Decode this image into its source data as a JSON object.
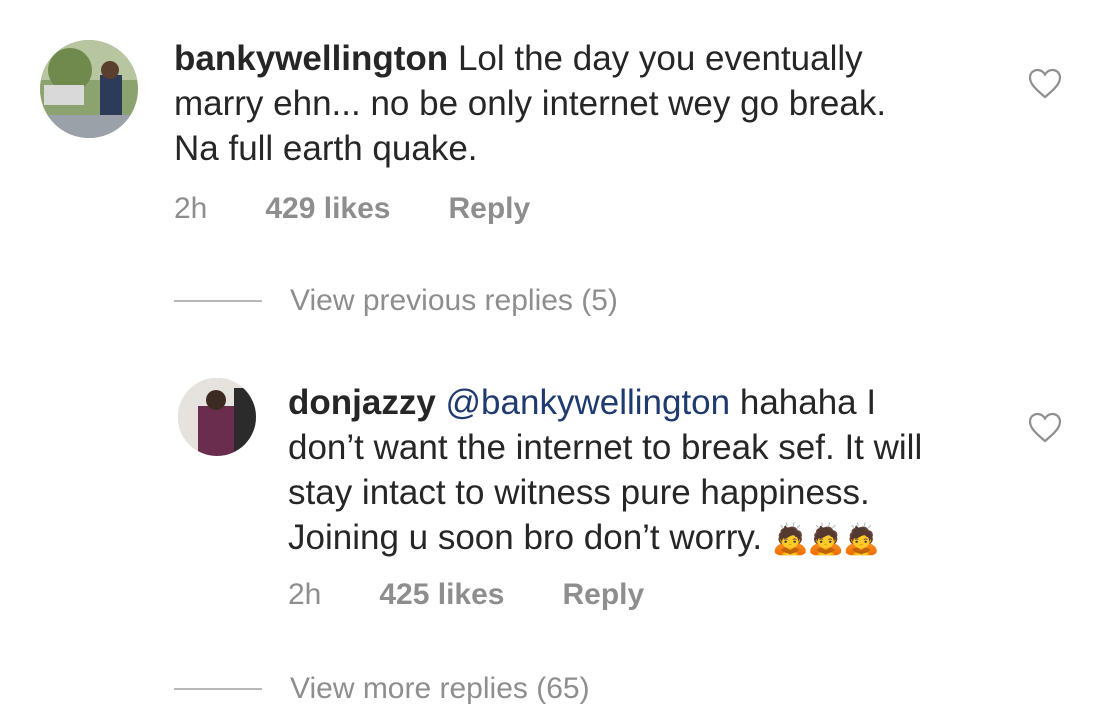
{
  "comments": [
    {
      "username": "bankywellington",
      "text_lines": [
        "Lol the day you eventually",
        "marry ehn... no be only internet wey go break.",
        "Na full earth quake."
      ],
      "time": "2h",
      "likes": "429 likes",
      "reply_label": "Reply",
      "view_replies": "View previous replies (5)"
    },
    {
      "username": "donjazzy",
      "mention": "@bankywellington",
      "text_lines": [
        "hahaha I",
        "don’t want the internet to break sef. It will",
        "stay intact to witness pure happiness.",
        "Joining u soon bro don’t worry."
      ],
      "emoji": "🙇🙇🙇",
      "time": "2h",
      "likes": "425 likes",
      "reply_label": "Reply",
      "view_replies": "View more replies (65)"
    }
  ],
  "icons": {
    "like": "heart-outline-icon",
    "heart_color": "#8e8e8e"
  }
}
